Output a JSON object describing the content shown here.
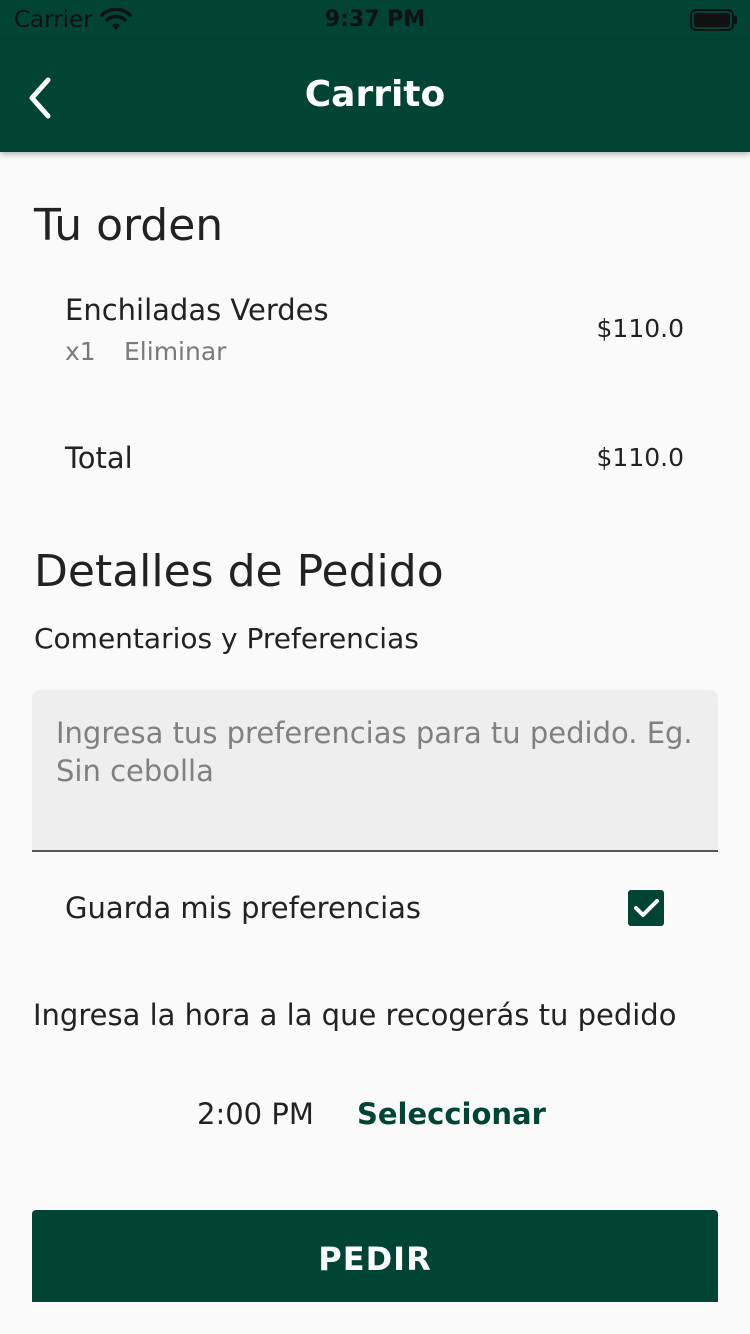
{
  "status_bar": {
    "carrier": "Carrier",
    "time": "9:37 PM"
  },
  "app_bar": {
    "title": "Carrito",
    "back_icon": "chevron-left-icon"
  },
  "order": {
    "heading": "Tu orden",
    "items": [
      {
        "name": "Enchiladas Verdes",
        "quantity": "x1",
        "remove_label": "Eliminar",
        "price": "$110.0"
      }
    ],
    "total_label": "Total",
    "total_value": "$110.0"
  },
  "details": {
    "heading": "Detalles de Pedido",
    "comments_label": "Comentarios y Preferencias",
    "placeholder": "Ingresa tus preferencias para tu pedido. Eg. Sin cebolla",
    "save_preferences_label": "Guarda mis preferencias",
    "save_preferences_checked": true,
    "pickup_prompt": "Ingresa la hora a la que recogerás tu pedido",
    "pickup_time": "2:00 PM",
    "select_label": "Seleccionar"
  },
  "actions": {
    "order_label": "PEDIR"
  },
  "colors": {
    "primary": "#004434",
    "background": "#fafafa",
    "field_bg": "#eeeeee",
    "muted_text": "#7a7a7a"
  }
}
